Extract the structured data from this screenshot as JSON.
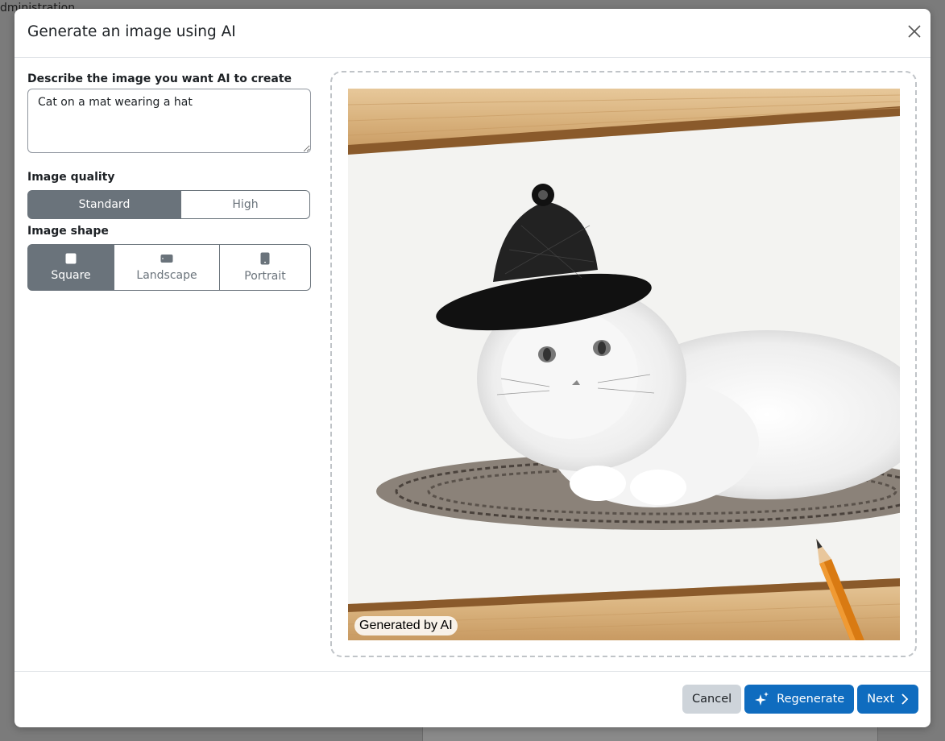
{
  "backdrop": {
    "top_text": "dministration"
  },
  "modal": {
    "title": "Generate an image using AI",
    "close_icon": "close-icon"
  },
  "form": {
    "prompt_label": "Describe the image you want AI to create",
    "prompt_value": "Cat on a mat wearing a hat",
    "quality_label": "Image quality",
    "quality_options": [
      {
        "label": "Standard",
        "selected": true
      },
      {
        "label": "High",
        "selected": false
      }
    ],
    "shape_label": "Image shape",
    "shape_options": [
      {
        "label": "Square",
        "icon": "square-icon",
        "selected": true
      },
      {
        "label": "Landscape",
        "icon": "landscape-icon",
        "selected": false
      },
      {
        "label": "Portrait",
        "icon": "portrait-icon",
        "selected": false
      }
    ]
  },
  "preview": {
    "badge": "Generated by AI"
  },
  "footer": {
    "cancel_label": "Cancel",
    "regenerate_label": "Regenerate",
    "next_label": "Next"
  },
  "colors": {
    "primary": "#0f6cbf",
    "secondary_active": "#6a737b",
    "cancel_bg": "#ced4da"
  }
}
